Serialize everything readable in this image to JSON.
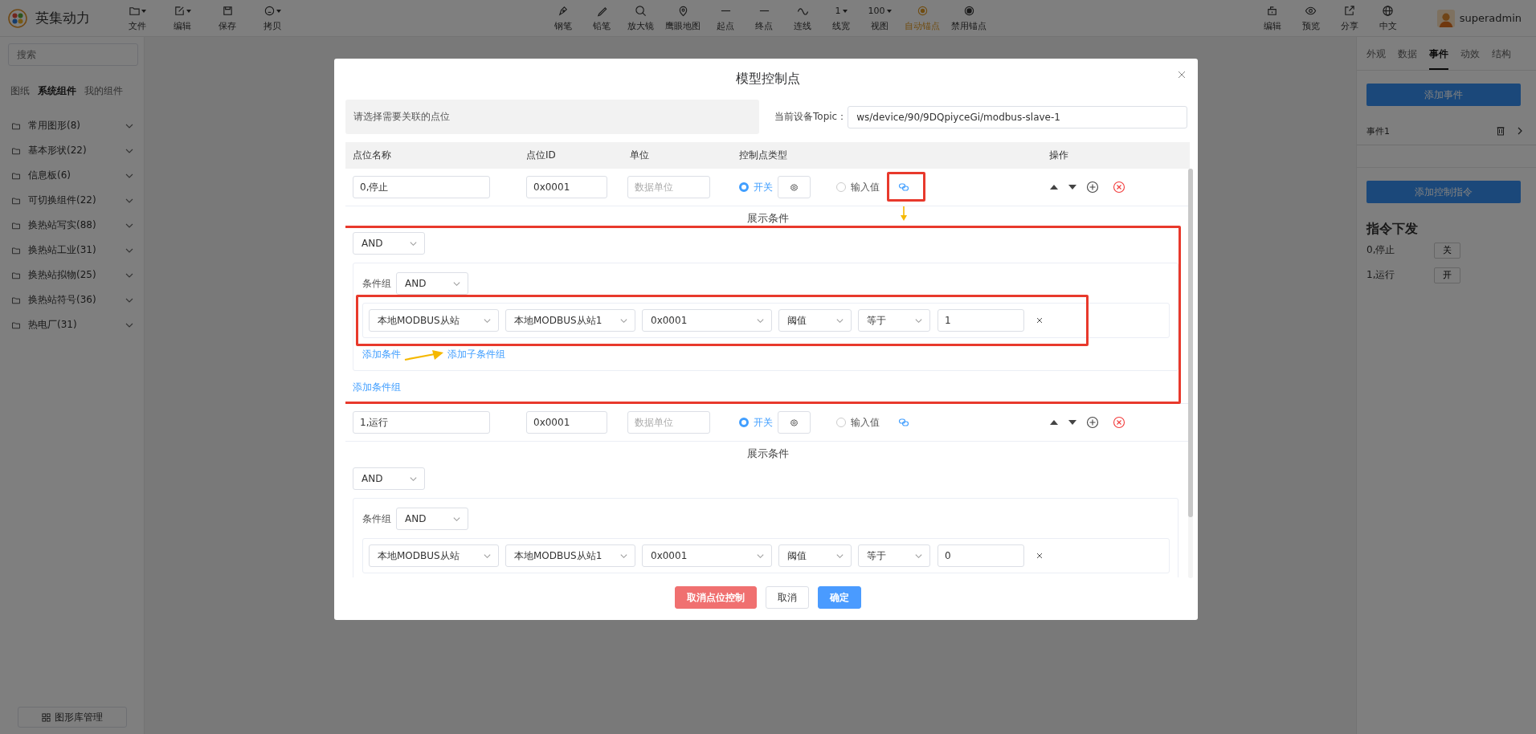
{
  "app": {
    "name": "英集动力"
  },
  "toolbar": {
    "file_tools": [
      {
        "label": "文件",
        "kind": "folder",
        "menu": true
      },
      {
        "label": "编辑",
        "kind": "edit",
        "menu": true
      },
      {
        "label": "保存",
        "kind": "save",
        "menu": false
      },
      {
        "label": "拷贝",
        "kind": "copy",
        "menu": true
      }
    ],
    "draw_tools": [
      {
        "label": "钢笔",
        "kind": "pen",
        "active": false
      },
      {
        "label": "铅笔",
        "kind": "pencil",
        "active": false
      },
      {
        "label": "放大镜",
        "kind": "magnifier",
        "active": false
      },
      {
        "label": "鹰眼地图",
        "kind": "pin",
        "active": false
      },
      {
        "label": "起点",
        "kind": "line",
        "active": false
      },
      {
        "label": "终点",
        "kind": "line",
        "active": false
      },
      {
        "label": "连线",
        "kind": "wave",
        "active": false
      },
      {
        "label": "线宽",
        "kind": "value",
        "value": "1",
        "active": false
      },
      {
        "label": "视图",
        "kind": "value",
        "value": "100",
        "active": false
      },
      {
        "label": "自动锚点",
        "kind": "anchor",
        "active": true
      },
      {
        "label": "禁用锚点",
        "kind": "anchor-off",
        "active": false
      }
    ],
    "view_tools": [
      {
        "label": "编辑",
        "kind": "edit-box"
      },
      {
        "label": "预览",
        "kind": "eye"
      },
      {
        "label": "分享",
        "kind": "share"
      },
      {
        "label": "中文",
        "kind": "globe"
      }
    ],
    "user": {
      "name": "superadmin"
    }
  },
  "sidebar": {
    "search": {
      "placeholder": "搜索"
    },
    "tabs": [
      {
        "label": "图纸",
        "selected": false
      },
      {
        "label": "系统组件",
        "selected": true
      },
      {
        "label": "我的组件",
        "selected": false
      }
    ],
    "groups": [
      {
        "label": "常用图形(8)",
        "expanded": false
      },
      {
        "label": "基本形状(22)",
        "expanded": false
      },
      {
        "label": "信息板(6)",
        "expanded": false
      },
      {
        "label": "可切换组件(22)",
        "expanded": false
      },
      {
        "label": "换热站写实(88)",
        "expanded": false
      },
      {
        "label": "换热站工业(31)",
        "expanded": false
      },
      {
        "label": "换热站拟物(25)",
        "expanded": false
      },
      {
        "label": "换热站符号(36)",
        "expanded": false
      },
      {
        "label": "热电厂(31)",
        "expanded": false
      }
    ],
    "footer_button": "图形库管理"
  },
  "right_panel": {
    "tabs": [
      {
        "label": "外观",
        "selected": false
      },
      {
        "label": "数据",
        "selected": false
      },
      {
        "label": "事件",
        "selected": true
      },
      {
        "label": "动效",
        "selected": false
      },
      {
        "label": "结构",
        "selected": false
      }
    ],
    "add_event_button": "添加事件",
    "events": [
      {
        "name": "事件1"
      }
    ],
    "add_command_button": "添加控制指令",
    "section_title": "指令下发",
    "commands": [
      {
        "name": "0,停止",
        "button": "关"
      },
      {
        "name": "1,运行",
        "button": "开"
      }
    ]
  },
  "dialog": {
    "title": "模型控制点",
    "point_select": {
      "placeholder": "请选择需要关联的点位"
    },
    "topic": {
      "label": "当前设备Topic：",
      "value": "ws/device/90/9DQpiyceGi/modbus-slave-1"
    },
    "columns": [
      "点位名称",
      "点位ID",
      "单位",
      "控制点类型",
      "操作"
    ],
    "rows": [
      {
        "name": "0,停止",
        "id": "0x0001",
        "unit_placeholder": "数据单位",
        "type_options": [
          {
            "label": "开关",
            "selected": true,
            "has_settings": true
          },
          {
            "label": "输入值",
            "selected": false,
            "has_settings": false
          }
        ],
        "link_highlighted": true,
        "conditions": {
          "title": "展示条件",
          "logic": "AND",
          "highlighted": true,
          "groups": [
            {
              "label": "条件组",
              "logic": "AND",
              "conditions": [
                {
                  "fields": [
                    "本地MODBUS从站",
                    "本地MODBUS从站1",
                    "0x0001",
                    "阈值",
                    "等于"
                  ],
                  "value": "1",
                  "highlighted": true
                }
              ],
              "add_condition": "添加条件",
              "add_subgroup": "添加子条件组"
            }
          ],
          "add_group": "添加条件组"
        }
      },
      {
        "name": "1,运行",
        "id": "0x0001",
        "unit_placeholder": "数据单位",
        "type_options": [
          {
            "label": "开关",
            "selected": true,
            "has_settings": true
          },
          {
            "label": "输入值",
            "selected": false,
            "has_settings": false
          }
        ],
        "link_highlighted": false,
        "conditions": {
          "title": "展示条件",
          "logic": "AND",
          "highlighted": false,
          "groups": [
            {
              "label": "条件组",
              "logic": "AND",
              "conditions": [
                {
                  "fields": [
                    "本地MODBUS从站",
                    "本地MODBUS从站1",
                    "0x0001",
                    "阈值",
                    "等于"
                  ],
                  "value": "0",
                  "highlighted": false
                }
              ]
            }
          ]
        }
      }
    ],
    "buttons": [
      {
        "label": "取消点位控制",
        "kind": "danger"
      },
      {
        "label": "取消",
        "kind": "default"
      },
      {
        "label": "确定",
        "kind": "primary"
      }
    ]
  }
}
